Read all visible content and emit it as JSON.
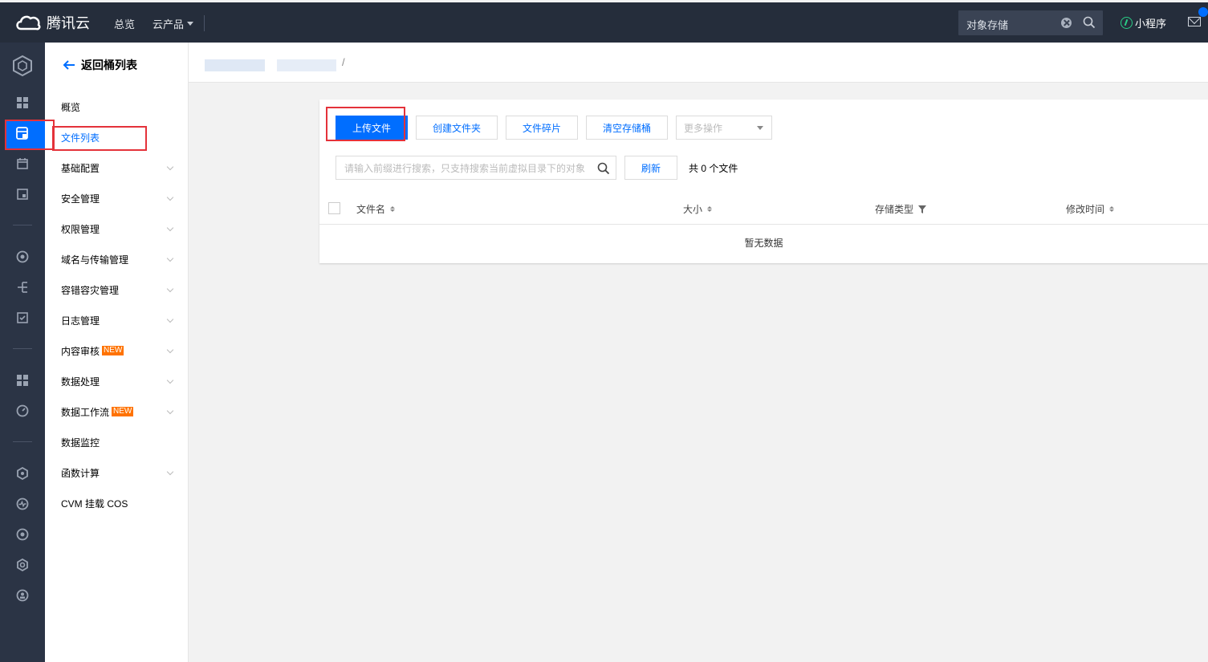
{
  "topbar": {
    "brand": "腾讯云",
    "nav_overview": "总览",
    "nav_products": "云产品",
    "search_value": "对象存储",
    "mini_program": "小程序"
  },
  "sidebar": {
    "back_label": "返回桶列表",
    "items": [
      {
        "label": "概览",
        "badge": ""
      },
      {
        "label": "文件列表",
        "badge": ""
      },
      {
        "label": "基础配置",
        "badge": ""
      },
      {
        "label": "安全管理",
        "badge": ""
      },
      {
        "label": "权限管理",
        "badge": ""
      },
      {
        "label": "域名与传输管理",
        "badge": ""
      },
      {
        "label": "容错容灾管理",
        "badge": ""
      },
      {
        "label": "日志管理",
        "badge": ""
      },
      {
        "label": "内容审核",
        "badge": "NEW"
      },
      {
        "label": "数据处理",
        "badge": ""
      },
      {
        "label": "数据工作流",
        "badge": "NEW"
      },
      {
        "label": "数据监控",
        "badge": ""
      },
      {
        "label": "函数计算",
        "badge": ""
      },
      {
        "label": "CVM 挂载 COS",
        "badge": ""
      }
    ]
  },
  "breadcrumb": {
    "separator": "/"
  },
  "toolbar": {
    "upload": "上传文件",
    "create_folder": "创建文件夹",
    "fragments": "文件碎片",
    "clear_bucket": "清空存储桶",
    "more_actions": "更多操作"
  },
  "search": {
    "placeholder": "请输入前缀进行搜索，只支持搜索当前虚拟目录下的对象",
    "refresh": "刷新",
    "count_text": "共 0 个文件"
  },
  "table": {
    "columns": [
      "文件名",
      "大小",
      "存储类型",
      "修改时间"
    ],
    "empty_text": "暂无数据"
  },
  "colors": {
    "accent": "#006eff",
    "topbar": "#252d3b",
    "rail": "#2b3445",
    "highlight_box": "#e4323a",
    "badge": "#ff7200"
  }
}
